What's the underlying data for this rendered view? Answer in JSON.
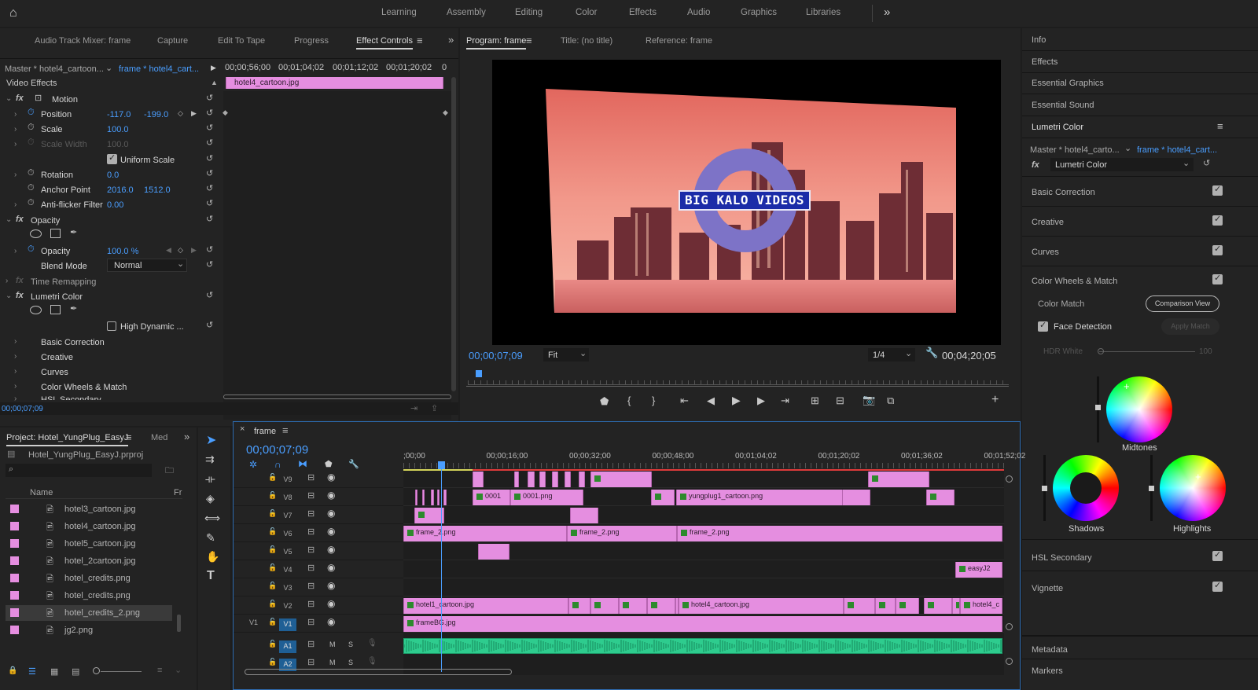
{
  "workspace": {
    "tabs": [
      "Learning",
      "Assembly",
      "Editing",
      "Color",
      "Effects",
      "Audio",
      "Graphics",
      "Libraries"
    ],
    "more": "»"
  },
  "top_left_tabs": [
    "Audio Track Mixer: frame",
    "Capture",
    "Edit To Tape",
    "Progress",
    "Effect Controls"
  ],
  "effect_controls": {
    "master_label": "Master * hotel4_cartoon...",
    "sequence_label": "frame * hotel4_cart...",
    "timecodes": [
      "00;00;56;00",
      "00;01;04;02",
      "00;01;12;02",
      "00;01;20;02",
      "0"
    ],
    "clip_name": "hotel4_cartoon.jpg",
    "section": "Video Effects",
    "motion": "Motion",
    "position_label": "Position",
    "position_x": "-117.0",
    "position_y": "-199.0",
    "scale_label": "Scale",
    "scale_val": "100.0",
    "scale_width_label": "Scale Width",
    "scale_width_val": "100.0",
    "uniform_scale": "Uniform Scale",
    "rotation_label": "Rotation",
    "rotation_val": "0.0",
    "anchor_label": "Anchor Point",
    "anchor_x": "2016.0",
    "anchor_y": "1512.0",
    "antiflicker_label": "Anti-flicker Filter",
    "antiflicker_val": "0.00",
    "opacity_section": "Opacity",
    "opacity_label": "Opacity",
    "opacity_val": "100.0 %",
    "blend_label": "Blend Mode",
    "blend_val": "Normal",
    "time_remap": "Time Remapping",
    "lumetri": "Lumetri Color",
    "high_dynamic": "High Dynamic ...",
    "lumetri_items": [
      "Basic Correction",
      "Creative",
      "Curves",
      "Color Wheels & Match",
      "HSL Secondary"
    ],
    "footer_time": "00;00;07;09"
  },
  "program": {
    "tabs": [
      "Program: frame",
      "Title: (no title)",
      "Reference: frame"
    ],
    "overlay_text": "BIG KALO VIDEOS",
    "timecode": "00;00;07;09",
    "fit": "Fit",
    "quality": "1/4",
    "duration": "00;04;20;05"
  },
  "right_panel": {
    "items": [
      "Info",
      "Effects",
      "Essential Graphics",
      "Essential Sound"
    ],
    "lumetri_title": "Lumetri Color",
    "master_label": "Master * hotel4_carto...",
    "sequence_label": "frame * hotel4_cart...",
    "effect_select": "Lumetri Color",
    "sections": [
      "Basic Correction",
      "Creative",
      "Curves",
      "Color Wheels & Match"
    ],
    "color_match": "Color Match",
    "comparison_view": "Comparison View",
    "face_detection": "Face Detection",
    "apply_match": "Apply Match",
    "hdr_white": "HDR White",
    "hdr_value": "100",
    "wheels": [
      "Midtones",
      "Shadows",
      "Highlights"
    ],
    "sections_bottom": [
      "HSL Secondary",
      "Vignette"
    ],
    "footer_items": [
      "Metadata",
      "Markers"
    ]
  },
  "project": {
    "tabs": [
      "Project: Hotel_YungPlug_EasyJ",
      "Med"
    ],
    "file": "Hotel_YungPlug_EasyJ.prproj",
    "col_name": "Name",
    "col_fr": "Fr",
    "items": [
      "hotel3_cartoon.jpg",
      "hotel4_cartoon.jpg",
      "hotel5_cartoon.jpg",
      "hotel_2cartoon.jpg",
      "hotel_credits.png",
      "hotel_credits.png",
      "hotel_credits_2.png",
      "jg2.png"
    ]
  },
  "timeline": {
    "tab": "frame",
    "timecode": "00;00;07;09",
    "ruler": [
      ";00;00",
      "00;00;16;00",
      "00;00;32;00",
      "00;00;48;00",
      "00;01;04;02",
      "00;01;20;02",
      "00;01;36;02",
      "00;01;52;02"
    ],
    "video_tracks": [
      "V9",
      "V8",
      "V7",
      "V6",
      "V5",
      "V4",
      "V3",
      "V2",
      "V1"
    ],
    "audio_tracks": [
      "A1",
      "A2"
    ],
    "source_v": "V1",
    "clip_labels": {
      "v8a": "0001",
      "v8b": "0001.png",
      "v8c": "yungplug1_cartoon.png",
      "v6a": "frame_2.png",
      "v6b": "frame_2.png",
      "v6c": "frame_2.png",
      "v4": "easyJ2",
      "v2a": "hotel1_cartoon.jpg",
      "v2b": "hotel4_cartoon.jpg",
      "v2c": "hotel4_c",
      "v1": "frameBG.jpg"
    }
  },
  "colors": {
    "accent": "#2d8ceb",
    "clip": "#e58ee0",
    "audio": "#2ecc8e",
    "playhead": "#4a9eff"
  }
}
